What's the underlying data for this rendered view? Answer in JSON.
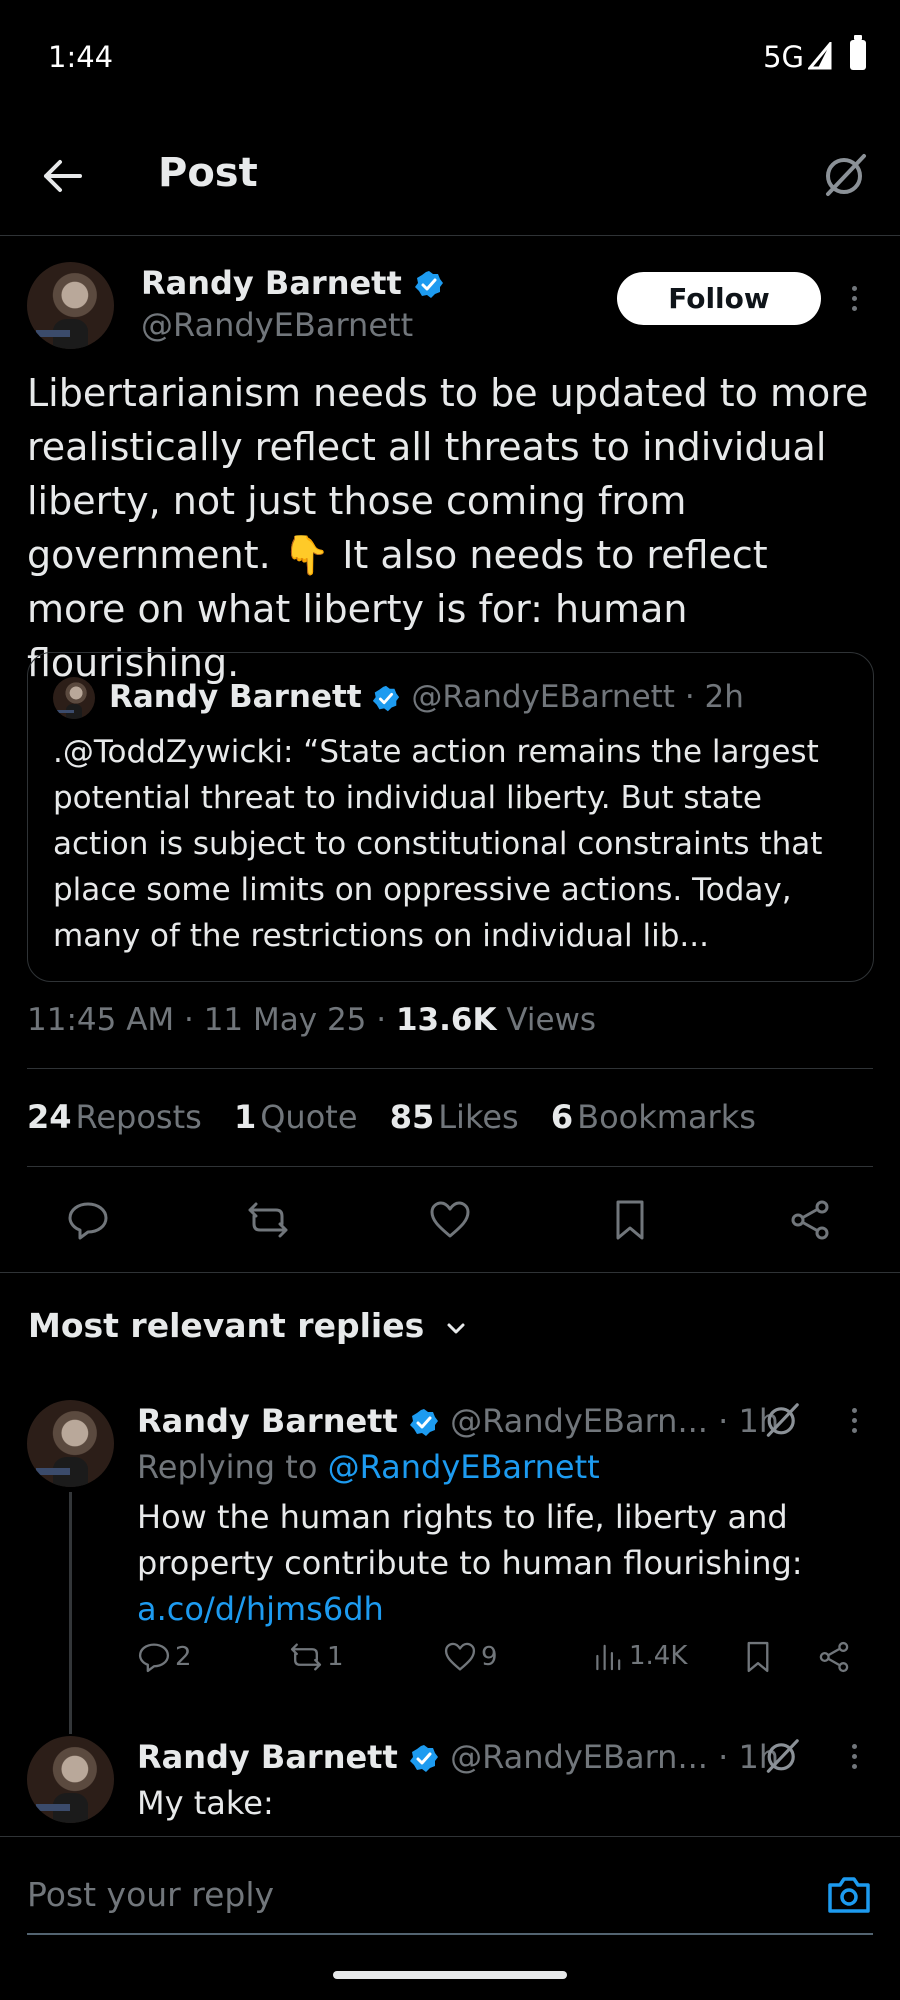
{
  "status_bar": {
    "time": "1:44",
    "network": "5G"
  },
  "header": {
    "title": "Post"
  },
  "post": {
    "author_name": "Randy Barnett",
    "author_handle": "@RandyEBarnett",
    "follow_label": "Follow",
    "text": "Libertarianism needs to be updated to more realistically reflect all threats to individual liberty, not just those coming from government. 👇 It also needs to reflect more on what liberty is for: human flourishing.",
    "quote": {
      "author_name": "Randy Barnett",
      "author_handle": "@RandyEBarnett",
      "age": "· 2h",
      "text": ".@ToddZywicki: “State action remains the largest potential threat to individual liberty. But state action is subject to constitutional constraints that place some limits on oppressive actions. Today, many of the restrictions on individual lib..."
    },
    "timestamp": "11:45 AM · 11 May 25 · ",
    "views_count": "13.6K",
    "views_label": "Views",
    "stats": [
      {
        "count": "24",
        "label": "Reposts"
      },
      {
        "count": "1",
        "label": "Quote"
      },
      {
        "count": "85",
        "label": "Likes"
      },
      {
        "count": "6",
        "label": "Bookmarks"
      }
    ]
  },
  "replies_filter": "Most relevant replies",
  "replies": [
    {
      "author_name": "Randy Barnett",
      "author_handle": "@RandyEBarn...",
      "age": "· 1h",
      "replying_to_prefix": "Replying to ",
      "replying_to_handle": "@RandyEBarnett",
      "text": "How the human rights to life, liberty and property contribute to human flourishing:",
      "link": "a.co/d/hjms6dh",
      "replies": "2",
      "reposts": "1",
      "likes": "9",
      "views": "1.4K"
    },
    {
      "author_name": "Randy Barnett",
      "author_handle": "@RandyEBarn...",
      "age": "· 1h",
      "text": "My take:"
    }
  ],
  "composer": {
    "placeholder": "Post your reply"
  },
  "colors": {
    "background": "#000000",
    "accent": "#1d9bf0",
    "muted": "#71767b",
    "text": "#e7e9ea"
  }
}
